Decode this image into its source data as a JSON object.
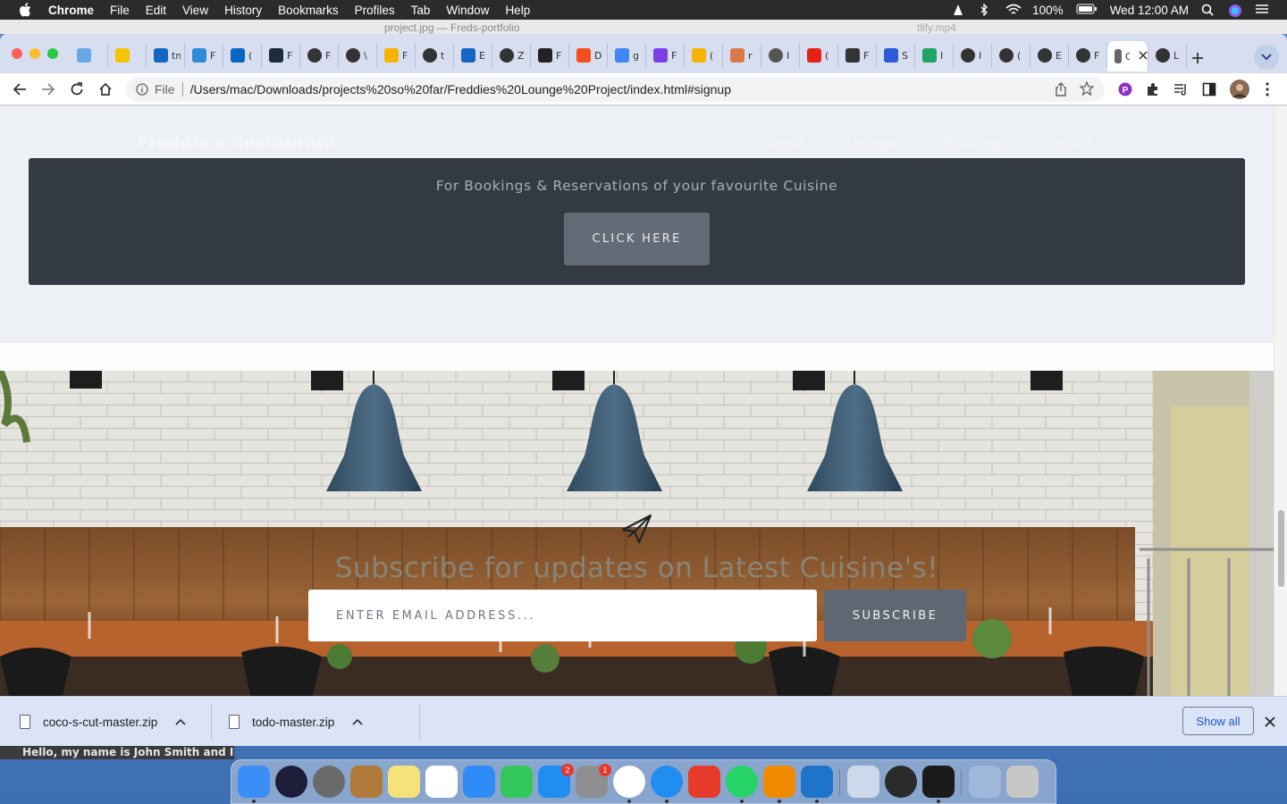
{
  "menubar": {
    "app": "Chrome",
    "items": [
      "File",
      "Edit",
      "View",
      "History",
      "Bookmarks",
      "Profiles",
      "Tab",
      "Window",
      "Help"
    ],
    "battery": "100%",
    "clock": "Wed 12:00 AM"
  },
  "behind_window": {
    "title": "project.jpg — Freds-portfolio",
    "title_right": "tlify.mp4",
    "caption": "Hello, my name is John Smith and I..."
  },
  "browser": {
    "tabs": [
      {
        "icon": "vscode-icon",
        "color": "#6aa7e6",
        "label": ""
      },
      {
        "icon": "mtn-icon",
        "color": "#f5c400",
        "label": ""
      },
      {
        "icon": "tm-icon",
        "color": "#1566c4",
        "label": "tm",
        "text": ""
      },
      {
        "icon": "diamond-icon",
        "color": "#2f8bd6",
        "label": "F"
      },
      {
        "icon": "linkedin-icon",
        "color": "#0a66c2",
        "label": "("
      },
      {
        "icon": "react-icon",
        "color": "#1d2b3a",
        "label": "F"
      },
      {
        "icon": "globe-icon",
        "color": "#333",
        "label": "F"
      },
      {
        "icon": "globe-icon",
        "color": "#333",
        "label": "\\"
      },
      {
        "icon": "netlify-icon",
        "color": "#f4b400",
        "label": "F"
      },
      {
        "icon": "github-icon",
        "color": "#333",
        "label": "t"
      },
      {
        "icon": "tm-icon",
        "color": "#1566c4",
        "label": "E"
      },
      {
        "icon": "globe-icon",
        "color": "#333",
        "label": "Z"
      },
      {
        "icon": "square-icon",
        "color": "#222",
        "label": "F"
      },
      {
        "icon": "figma-icon",
        "color": "#f24e1e",
        "label": "D"
      },
      {
        "icon": "google-icon",
        "color": "#4285f4",
        "label": "g"
      },
      {
        "icon": "circle-g-icon",
        "color": "#7b3fe4",
        "label": "F"
      },
      {
        "icon": "bolt-icon",
        "color": "#f7b500",
        "label": "("
      },
      {
        "icon": "stack-icon",
        "color": "#d9794a",
        "label": "r"
      },
      {
        "icon": "chrome-icon",
        "color": "#555",
        "label": "I"
      },
      {
        "icon": "youtube-icon",
        "color": "#e62117",
        "label": "("
      },
      {
        "icon": "app-icon",
        "color": "#333",
        "label": "F"
      },
      {
        "icon": "dropbox-icon",
        "color": "#2f5bd8",
        "label": "S"
      },
      {
        "icon": "drive-icon",
        "color": "#1fa463",
        "label": "I"
      },
      {
        "icon": "globe-icon",
        "color": "#333",
        "label": "I"
      },
      {
        "icon": "globe-icon",
        "color": "#333",
        "label": "("
      },
      {
        "icon": "github-icon",
        "color": "#333",
        "label": "E"
      },
      {
        "icon": "github-icon",
        "color": "#333",
        "label": "F"
      },
      {
        "icon": "page-icon",
        "color": "#666",
        "label": "G",
        "active": true
      },
      {
        "icon": "github-icon",
        "color": "#333",
        "label": "L"
      }
    ],
    "omnibox": {
      "scheme": "File",
      "url": "/Users/mac/Downloads/projects%20so%20far/Freddies%20Lounge%20Project/index.html#signup"
    }
  },
  "page": {
    "brand": "Freddie's Restaurant",
    "nav": [
      "About",
      "Lounges",
      "Booking",
      "Contact"
    ],
    "cta": {
      "text": "For Bookings & Reservations of your favourite Cuisine",
      "button": "CLICK HERE"
    },
    "subscribe": {
      "title": "Subscribe for updates on Latest Cuisine's!",
      "placeholder": "ENTER EMAIL ADDRESS...",
      "button": "SUBSCRIBE"
    }
  },
  "downloads": {
    "items": [
      {
        "name": "coco-s-cut-master.zip"
      },
      {
        "name": "todo-master.zip"
      }
    ],
    "show_all": "Show all"
  },
  "dock": {
    "apps": [
      "finder-icon",
      "siri-icon",
      "launchpad-icon",
      "notes-brown-icon",
      "notes-icon",
      "photos-icon",
      "messages-icon",
      "facetime-icon",
      "appstore-icon",
      "settings-icon",
      "chrome-icon",
      "safari-icon",
      "wps-icon",
      "whatsapp-icon",
      "vlc-icon",
      "vscode-icon",
      "preview-icon",
      "quicktime-icon",
      "terminal-icon",
      "downloads-folder-icon",
      "trash-icon"
    ],
    "badges": {
      "appstore": "2",
      "settings": "1"
    }
  }
}
